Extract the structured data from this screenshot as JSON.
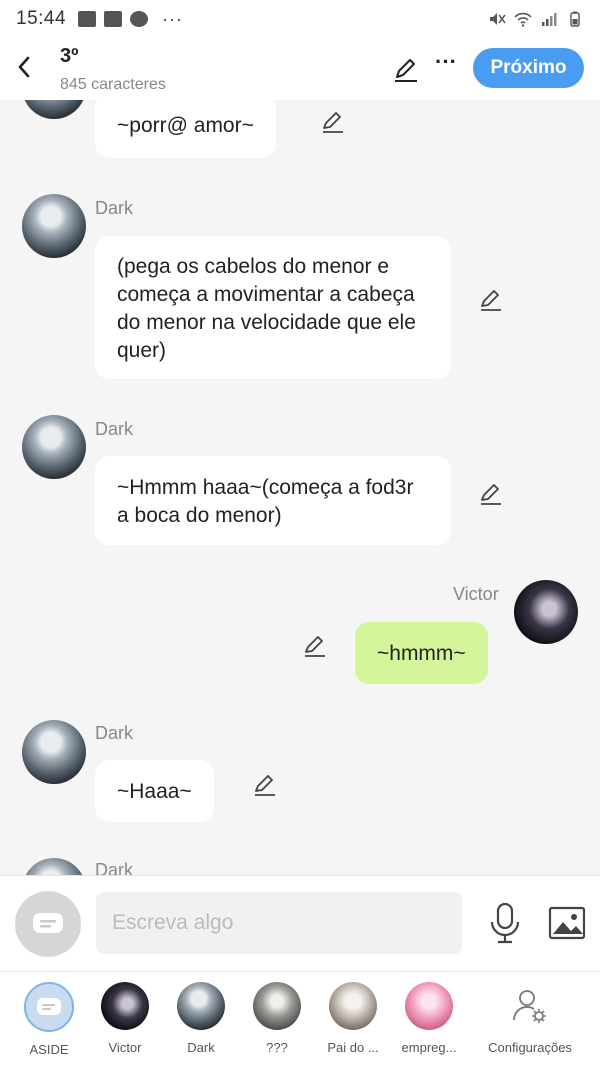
{
  "statusbar": {
    "time": "15:44",
    "dots": "···"
  },
  "header": {
    "title": "3º",
    "subtitle": "845 caracteres",
    "more": "···",
    "next_label": "Próximo"
  },
  "messages": [
    {
      "author": "",
      "text": "~porr@ amor~"
    },
    {
      "author": "Dark",
      "text": "(pega os cabelos do menor e começa a movimentar a cabeça  do menor na velocidade que ele quer)"
    },
    {
      "author": "Dark",
      "text": "~Hmmm haaa~(começa a fod3r a boca do menor)"
    },
    {
      "author": "Victor",
      "text": "~hmmm~"
    },
    {
      "author": "Dark",
      "text": "~Haaa~"
    },
    {
      "author": "Dark",
      "text": ""
    }
  ],
  "input": {
    "placeholder": "Escreva algo"
  },
  "nav": [
    {
      "label": "ASIDE"
    },
    {
      "label": "Victor"
    },
    {
      "label": "Dark"
    },
    {
      "label": "???"
    },
    {
      "label": "Pai do ..."
    },
    {
      "label": "empreg..."
    },
    {
      "label": "Configurações"
    }
  ],
  "colors": {
    "accent": "#4a9cf0",
    "own_bubble": "#d4f59a",
    "other_bubble": "#ffffff",
    "background": "#f5f5f5"
  }
}
